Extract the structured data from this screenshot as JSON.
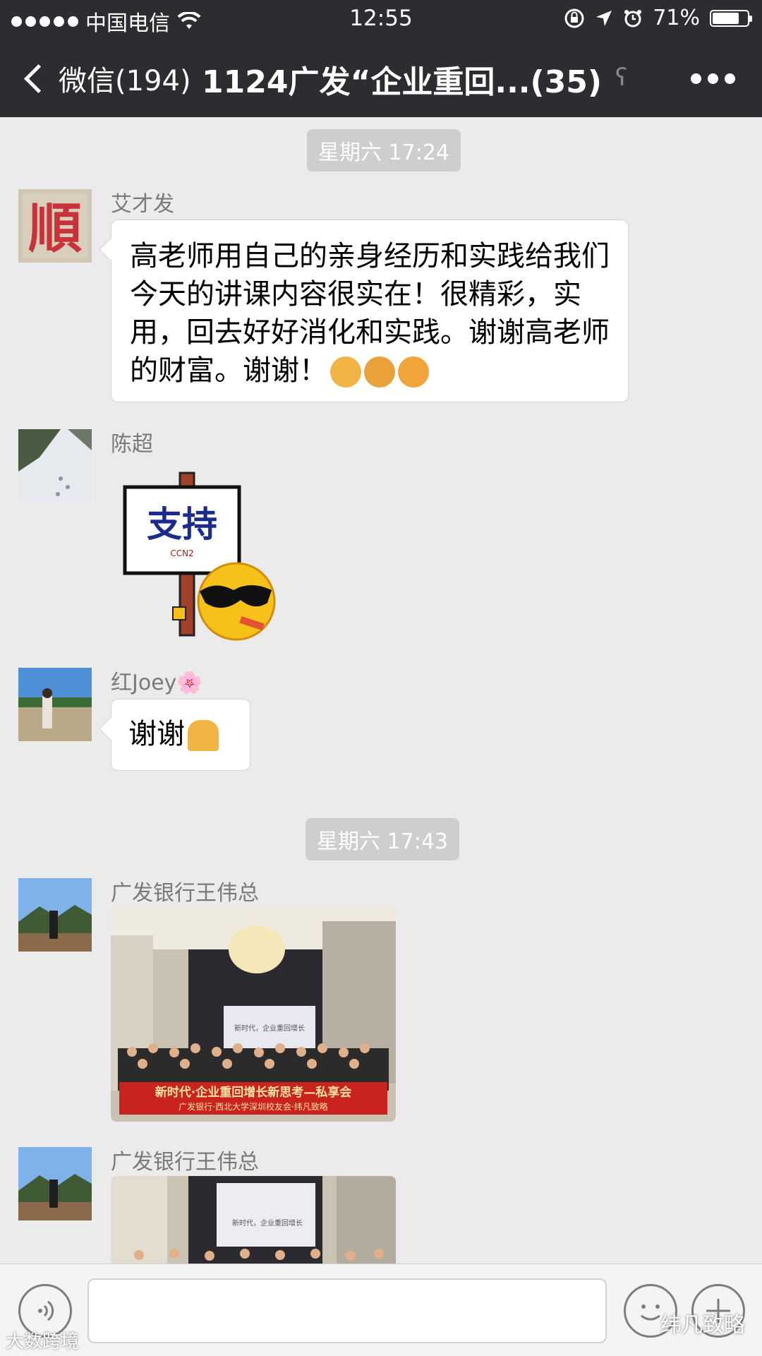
{
  "status": {
    "carrier": "中国电信",
    "time": "12:55",
    "battery": "71%",
    "battery_level": 0.71
  },
  "nav": {
    "back_label": "微信(194)",
    "title": "1124广发“企业重回...(35)"
  },
  "messages": [
    {
      "time": "星期六 17:24"
    },
    {
      "sender": "艾才发",
      "avatar_char": "順",
      "text": "高老师用自己的亲身经历和实践给我们今天的讲课内容很实在！很精彩，实用，回去好好消化和实践。谢谢高老师的财富。谢谢！",
      "emojis": [
        "thumbs-up",
        "handshake",
        "fist"
      ]
    },
    {
      "sender": "陈超",
      "sticker": {
        "sign_text": "支持",
        "sign_small": "CCN2",
        "face": "sunglasses-cigar"
      }
    },
    {
      "sender": "红Joey🌸",
      "text": "谢谢",
      "emojis": [
        "pray"
      ]
    },
    {
      "time": "星期六 17:43"
    },
    {
      "sender": "广发银行王伟总",
      "photo": {
        "banner_line1": "新时代·企业重回增长新思考—私享会",
        "banner_line2": "广发银行·西北大学深圳校友会·纬凡致略",
        "screen_text": "新时代，企业重回增长"
      }
    },
    {
      "sender": "广发银行王伟总",
      "photo": {
        "screen_text": "新时代，企业重回增长"
      }
    }
  ],
  "watermarks": {
    "left": "大数跨境",
    "right": "纬凡致略"
  },
  "colors": {
    "nav_bg": "#2d2d31",
    "chat_bg": "#ebebeb",
    "banner_red": "#c8231f"
  }
}
